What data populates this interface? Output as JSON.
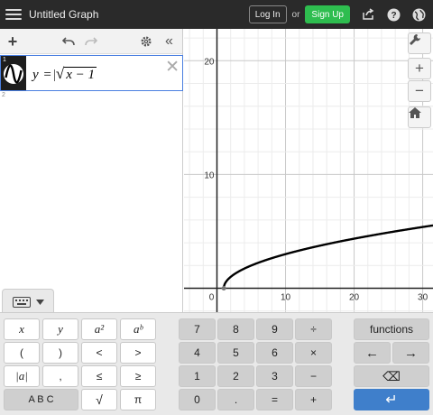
{
  "topbar": {
    "title": "Untitled Graph",
    "login_label": "Log In",
    "or_label": "or",
    "signup_label": "Sign Up"
  },
  "expressions": [
    {
      "number": "1",
      "latex_display": "y = √(x − 1)",
      "lhs": "y",
      "eq": "=",
      "radicand": "x − 1"
    },
    {
      "number": "2",
      "latex_display": ""
    }
  ],
  "graph": {
    "x_ticks": [
      "0",
      "10",
      "20",
      "30"
    ],
    "y_ticks": [
      "10",
      "20"
    ],
    "curve_color": "#000000",
    "function": "sqrt(x-1)",
    "x_range": [
      -4.8,
      31.5
    ],
    "y_range": [
      -2.1,
      22.8
    ]
  },
  "keypad": {
    "row1": [
      "x",
      "y",
      "a²",
      "aᵇ",
      "7",
      "8",
      "9",
      "÷",
      "functions"
    ],
    "row2": [
      "(",
      ")",
      "<",
      ">",
      "4",
      "5",
      "6",
      "×",
      "←",
      "→"
    ],
    "row3": [
      "|a|",
      ",",
      "≤",
      "≥",
      "1",
      "2",
      "3",
      "−",
      "⌫"
    ],
    "row4": [
      "A B C",
      "√",
      "π",
      "0",
      ".",
      "=",
      "+",
      "↵"
    ]
  }
}
